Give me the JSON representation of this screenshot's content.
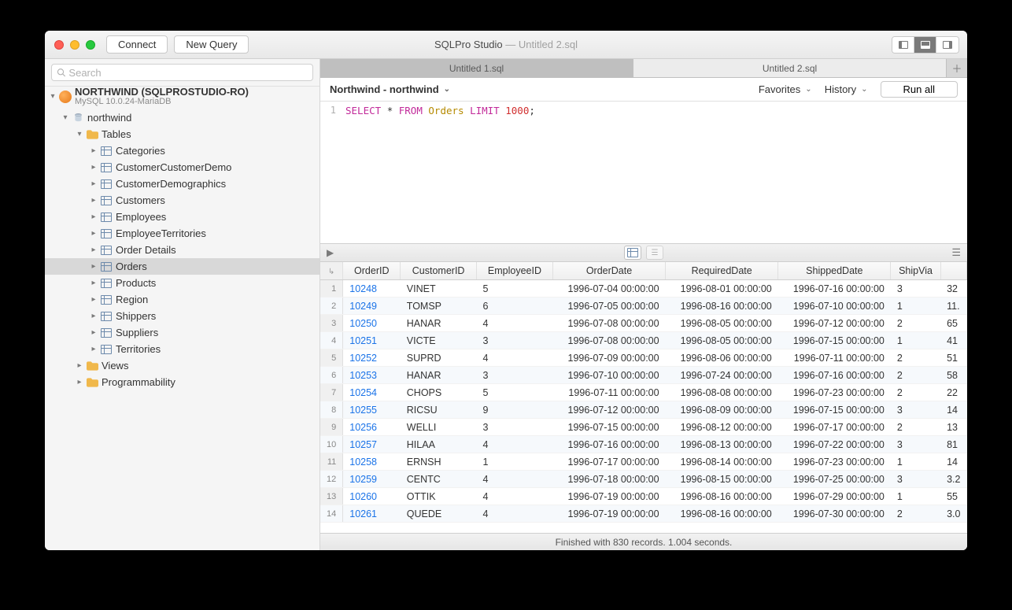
{
  "window": {
    "app_name": "SQLPro Studio",
    "document": "Untitled 2.sql"
  },
  "toolbar": {
    "connect": "Connect",
    "new_query": "New Query"
  },
  "sidebar": {
    "search_placeholder": "Search",
    "connection": {
      "name": "NORTHWIND (SQLPROSTUDIO-RO)",
      "subtitle": "MySQL 10.0.24-MariaDB"
    },
    "database": "northwind",
    "tables_label": "Tables",
    "tables": [
      "Categories",
      "CustomerCustomerDemo",
      "CustomerDemographics",
      "Customers",
      "Employees",
      "EmployeeTerritories",
      "Order Details",
      "Orders",
      "Products",
      "Region",
      "Shippers",
      "Suppliers",
      "Territories"
    ],
    "selected_table": "Orders",
    "views_label": "Views",
    "programmability_label": "Programmability"
  },
  "file_tabs": [
    "Untitled 1.sql",
    "Untitled 2.sql"
  ],
  "active_file_tab": 1,
  "sub_toolbar": {
    "context": "Northwind - northwind",
    "favorites": "Favorites",
    "history": "History",
    "run_all": "Run all"
  },
  "editor": {
    "line_number": "1",
    "tokens": {
      "select": "SELECT",
      "star": "*",
      "from": "FROM",
      "table": "Orders",
      "limit": "LIMIT",
      "n": "1000",
      "semi": ";"
    }
  },
  "result_columns": [
    "OrderID",
    "CustomerID",
    "EmployeeID",
    "OrderDate",
    "RequiredDate",
    "ShippedDate",
    "ShipVia",
    ""
  ],
  "result_rows": [
    {
      "n": "1",
      "OrderID": "10248",
      "CustomerID": "VINET",
      "EmployeeID": "5",
      "OrderDate": "1996-07-04 00:00:00",
      "RequiredDate": "1996-08-01 00:00:00",
      "ShippedDate": "1996-07-16 00:00:00",
      "ShipVia": "3",
      "Extra": "32"
    },
    {
      "n": "2",
      "OrderID": "10249",
      "CustomerID": "TOMSP",
      "EmployeeID": "6",
      "OrderDate": "1996-07-05 00:00:00",
      "RequiredDate": "1996-08-16 00:00:00",
      "ShippedDate": "1996-07-10 00:00:00",
      "ShipVia": "1",
      "Extra": "11."
    },
    {
      "n": "3",
      "OrderID": "10250",
      "CustomerID": "HANAR",
      "EmployeeID": "4",
      "OrderDate": "1996-07-08 00:00:00",
      "RequiredDate": "1996-08-05 00:00:00",
      "ShippedDate": "1996-07-12 00:00:00",
      "ShipVia": "2",
      "Extra": "65"
    },
    {
      "n": "4",
      "OrderID": "10251",
      "CustomerID": "VICTE",
      "EmployeeID": "3",
      "OrderDate": "1996-07-08 00:00:00",
      "RequiredDate": "1996-08-05 00:00:00",
      "ShippedDate": "1996-07-15 00:00:00",
      "ShipVia": "1",
      "Extra": "41"
    },
    {
      "n": "5",
      "OrderID": "10252",
      "CustomerID": "SUPRD",
      "EmployeeID": "4",
      "OrderDate": "1996-07-09 00:00:00",
      "RequiredDate": "1996-08-06 00:00:00",
      "ShippedDate": "1996-07-11 00:00:00",
      "ShipVia": "2",
      "Extra": "51"
    },
    {
      "n": "6",
      "OrderID": "10253",
      "CustomerID": "HANAR",
      "EmployeeID": "3",
      "OrderDate": "1996-07-10 00:00:00",
      "RequiredDate": "1996-07-24 00:00:00",
      "ShippedDate": "1996-07-16 00:00:00",
      "ShipVia": "2",
      "Extra": "58"
    },
    {
      "n": "7",
      "OrderID": "10254",
      "CustomerID": "CHOPS",
      "EmployeeID": "5",
      "OrderDate": "1996-07-11 00:00:00",
      "RequiredDate": "1996-08-08 00:00:00",
      "ShippedDate": "1996-07-23 00:00:00",
      "ShipVia": "2",
      "Extra": "22"
    },
    {
      "n": "8",
      "OrderID": "10255",
      "CustomerID": "RICSU",
      "EmployeeID": "9",
      "OrderDate": "1996-07-12 00:00:00",
      "RequiredDate": "1996-08-09 00:00:00",
      "ShippedDate": "1996-07-15 00:00:00",
      "ShipVia": "3",
      "Extra": "14"
    },
    {
      "n": "9",
      "OrderID": "10256",
      "CustomerID": "WELLI",
      "EmployeeID": "3",
      "OrderDate": "1996-07-15 00:00:00",
      "RequiredDate": "1996-08-12 00:00:00",
      "ShippedDate": "1996-07-17 00:00:00",
      "ShipVia": "2",
      "Extra": "13"
    },
    {
      "n": "10",
      "OrderID": "10257",
      "CustomerID": "HILAA",
      "EmployeeID": "4",
      "OrderDate": "1996-07-16 00:00:00",
      "RequiredDate": "1996-08-13 00:00:00",
      "ShippedDate": "1996-07-22 00:00:00",
      "ShipVia": "3",
      "Extra": "81"
    },
    {
      "n": "11",
      "OrderID": "10258",
      "CustomerID": "ERNSH",
      "EmployeeID": "1",
      "OrderDate": "1996-07-17 00:00:00",
      "RequiredDate": "1996-08-14 00:00:00",
      "ShippedDate": "1996-07-23 00:00:00",
      "ShipVia": "1",
      "Extra": "14"
    },
    {
      "n": "12",
      "OrderID": "10259",
      "CustomerID": "CENTC",
      "EmployeeID": "4",
      "OrderDate": "1996-07-18 00:00:00",
      "RequiredDate": "1996-08-15 00:00:00",
      "ShippedDate": "1996-07-25 00:00:00",
      "ShipVia": "3",
      "Extra": "3.2"
    },
    {
      "n": "13",
      "OrderID": "10260",
      "CustomerID": "OTTIK",
      "EmployeeID": "4",
      "OrderDate": "1996-07-19 00:00:00",
      "RequiredDate": "1996-08-16 00:00:00",
      "ShippedDate": "1996-07-29 00:00:00",
      "ShipVia": "1",
      "Extra": "55"
    },
    {
      "n": "14",
      "OrderID": "10261",
      "CustomerID": "QUEDE",
      "EmployeeID": "4",
      "OrderDate": "1996-07-19 00:00:00",
      "RequiredDate": "1996-08-16 00:00:00",
      "ShippedDate": "1996-07-30 00:00:00",
      "ShipVia": "2",
      "Extra": "3.0"
    }
  ],
  "status": "Finished with 830 records. 1.004 seconds."
}
